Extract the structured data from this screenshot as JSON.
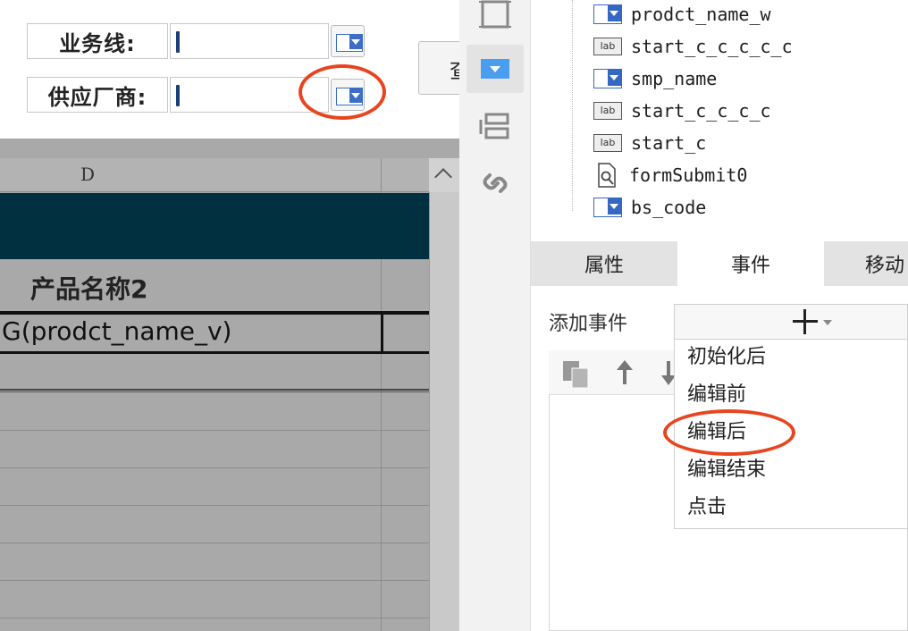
{
  "form": {
    "business_line_label": "业务线:",
    "supplier_label": "供应厂商:",
    "query_label": "查"
  },
  "grid": {
    "column_header": "D",
    "product_name_header": "产品名称2",
    "formula_cell": "G(prodct_name_v)"
  },
  "tree": {
    "items": [
      {
        "type": "dropdown",
        "label": "prodct_name_w"
      },
      {
        "type": "label",
        "label": "start_c_c_c_c_c"
      },
      {
        "type": "dropdown",
        "label": "smp_name"
      },
      {
        "type": "label",
        "label": "start_c_c_c_c"
      },
      {
        "type": "label",
        "label": "start_c"
      },
      {
        "type": "form",
        "label": "formSubmit0"
      },
      {
        "type": "dropdown",
        "label": "bs_code"
      }
    ],
    "lab_icon_text": "lab"
  },
  "tabs": [
    "属性",
    "事件",
    "移动"
  ],
  "events": {
    "add_label": "添加事件",
    "menu": [
      "初始化后",
      "编辑前",
      "编辑后",
      "编辑结束",
      "点击"
    ]
  },
  "colors": {
    "highlight": "#e8441f",
    "grid_band": "#013040",
    "icon_blue": "#3568c4"
  }
}
